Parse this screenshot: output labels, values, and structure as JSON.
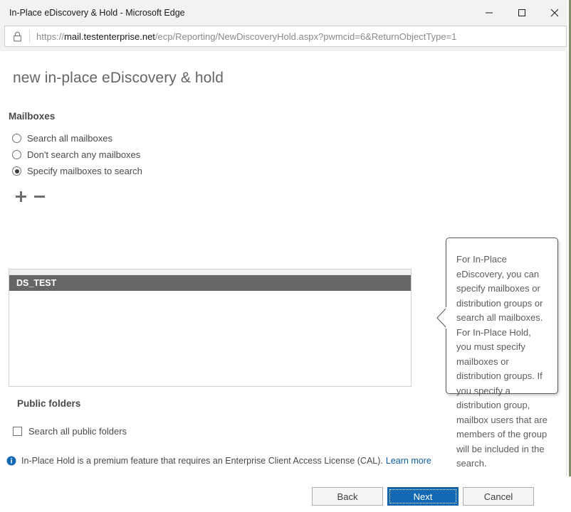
{
  "window": {
    "title": "In-Place eDiscovery & Hold - Microsoft Edge",
    "minimize_label": "Minimize",
    "maximize_label": "Maximize",
    "close_label": "Close"
  },
  "address_bar": {
    "lock_icon": "lock-icon",
    "url_scheme": "https://",
    "url_host": "mail.testenterprise.net",
    "url_path": "/ecp/Reporting/NewDiscoveryHold.aspx?pwmcid=6&ReturnObjectType=1"
  },
  "page": {
    "title": "new in-place eDiscovery & hold",
    "mailboxes_label": "Mailboxes",
    "public_folders_label": "Public folders"
  },
  "radios": [
    {
      "label": "Search all mailboxes",
      "checked": false
    },
    {
      "label": "Don't search any mailboxes",
      "checked": false
    },
    {
      "label": "Specify mailboxes to search",
      "checked": true
    }
  ],
  "toolbar": {
    "add_icon": "plus-icon",
    "remove_icon": "minus-icon"
  },
  "mailbox_list": {
    "rows": [
      {
        "name": "DS_TEST",
        "selected": true
      }
    ]
  },
  "public_folders": {
    "checkbox_label": "Search all public folders",
    "checked": false
  },
  "info_note": {
    "icon": "info-circle-icon",
    "text": "In-Place Hold is a premium feature that requires an Enterprise Client Access License (CAL).",
    "link_text": "Learn more"
  },
  "callout": {
    "text": "For In-Place eDiscovery, you can specify mailboxes or distribution groups or search all mailboxes. For In-Place Hold, you must specify mailboxes or distribution groups. If you specify a distribution group, mailbox users that are members of the group will be included in the search."
  },
  "footer": {
    "back_label": "Back",
    "next_label": "Next",
    "cancel_label": "Cancel"
  },
  "colors": {
    "accent_blue": "#1268b3",
    "link_blue": "#0a5fa8",
    "selected_row": "#666666",
    "title_gray": "#666666"
  }
}
